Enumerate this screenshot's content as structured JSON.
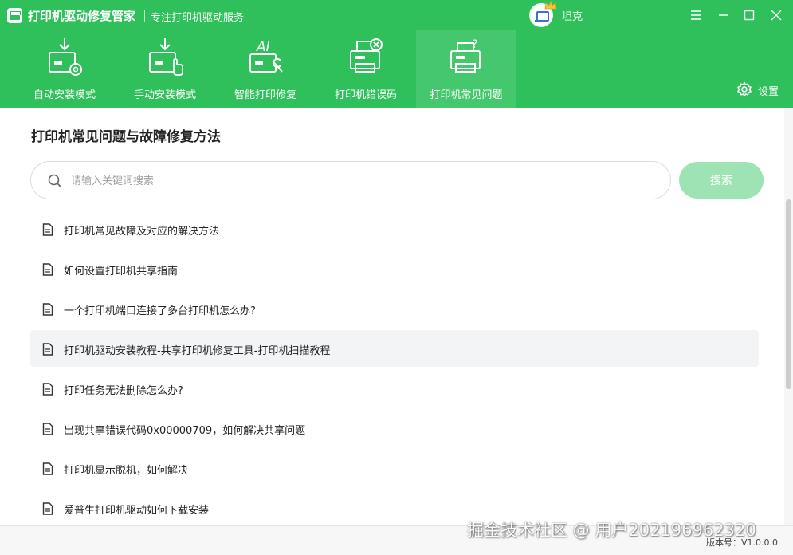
{
  "app": {
    "name": "打印机驱动修复管家",
    "slogan": "专注打印机驱动服务"
  },
  "user": {
    "name": "坦克"
  },
  "window_controls": {
    "menu_icon": "menu-icon",
    "minimize_icon": "minimize-icon",
    "maximize_icon": "maximize-icon",
    "close_icon": "close-icon"
  },
  "nav": {
    "tabs": [
      {
        "label": "自动安装模式",
        "icon": "auto-install-icon"
      },
      {
        "label": "手动安装模式",
        "icon": "manual-install-icon"
      },
      {
        "label": "智能打印修复",
        "icon": "ai-repair-icon"
      },
      {
        "label": "打印机错误码",
        "icon": "printer-error-icon"
      },
      {
        "label": "打印机常见问题",
        "icon": "printer-faq-icon",
        "active": true
      }
    ],
    "settings_label": "设置"
  },
  "main": {
    "title": "打印机常见问题与故障修复方法",
    "search": {
      "placeholder": "请输入关键词搜索",
      "value": "",
      "button_label": "搜索"
    },
    "faq_items": [
      "打印机常见故障及对应的解决方法",
      "如何设置打印机共享指南",
      "一个打印机端口连接了多台打印机怎么办?",
      "打印机驱动安装教程-共享打印机修复工具-打印机扫描教程",
      "打印任务无法删除怎么办?",
      "出现共享错误代码0x00000709，如何解决共享问题",
      "打印机显示脱机，如何解决",
      "爱普生打印机驱动如何下载安装"
    ],
    "hovered_item_index": 3
  },
  "footer": {
    "version": "版本号：V1.0.0.0",
    "watermark": "掘金技术社区 @ 用户2021969623‍20"
  },
  "colors": {
    "brand_green": "#2fc05c",
    "active_tab": "#45c86d",
    "search_button": "#9ee3b3"
  }
}
